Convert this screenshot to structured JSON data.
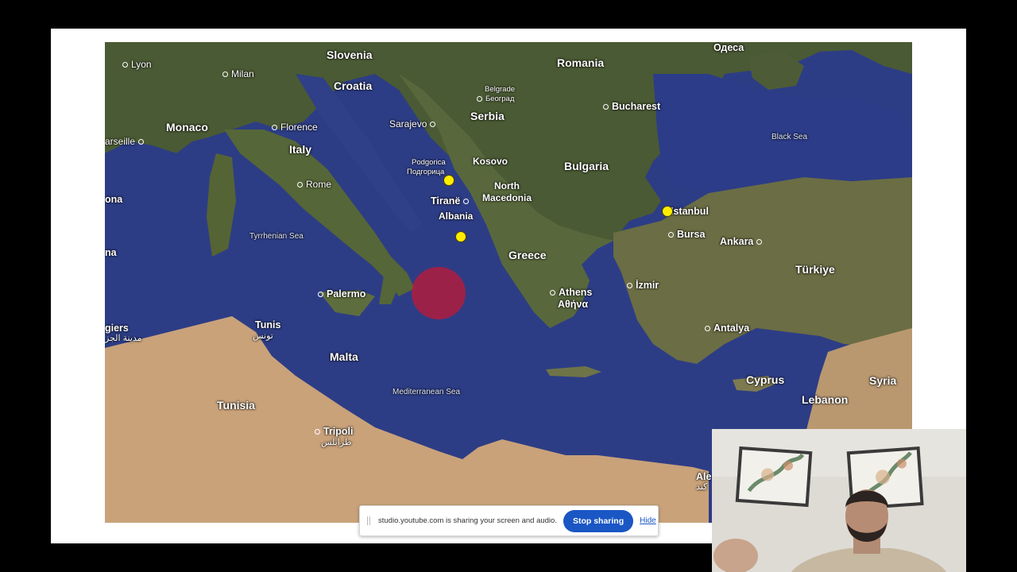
{
  "map": {
    "countries": {
      "slovenia": "Slovenia",
      "croatia": "Croatia",
      "romania": "Romania",
      "serbia": "Serbia",
      "bulgaria": "Bulgaria",
      "kosovo": "Kosovo",
      "north_macedonia_1": "North",
      "north_macedonia_2": "Macedonia",
      "albania": "Albania",
      "greece": "Greece",
      "italy": "Italy",
      "monaco": "Monaco",
      "malta": "Malta",
      "tunisia": "Tunisia",
      "turkiye": "Türkiye",
      "cyprus": "Cyprus",
      "lebanon": "Lebanon",
      "syria": "Syria"
    },
    "cities": {
      "lyon": "Lyon",
      "milan": "Milan",
      "marseille": "arseille",
      "florence": "Florence",
      "rome": "Rome",
      "sarajevo": "Sarajevo",
      "belgrade_1": "Belgrade",
      "belgrade_2": "Београд",
      "bucharest": "Bucharest",
      "odesa": "Одеса",
      "podgorica_1": "Podgorica",
      "podgorica_2": "Подгорица",
      "tirane": "Tiranë",
      "istanbul": "Istanbul",
      "bursa": "Bursa",
      "ankara": "Ankara",
      "izmir": "İzmir",
      "athens_1": "Athens",
      "athens_2": "Αθήνα",
      "palermo": "Palermo",
      "tunis_1": "Tunis",
      "tunis_2": "تونس",
      "algiers_1": "giers",
      "algiers_2": "مدينة الجز",
      "antalya": "Antalya",
      "tripoli_1": "Tripoli",
      "tripoli_2": "طرابلس",
      "alexandria_1": "Ale",
      "alexandria_2": "كند",
      "barcelona": "ona",
      "valencia": "na"
    },
    "seas": {
      "black": "Black Sea",
      "tyrrhenian": "Tyrrhenian Sea",
      "mediterranean": "Mediterranean Sea"
    }
  },
  "share_bar": {
    "message": "studio.youtube.com is sharing your screen and audio.",
    "stop_label": "Stop sharing",
    "hide_label": "Hide"
  },
  "colors": {
    "marker": "#ffee00",
    "zone": "#c81632",
    "stop_button": "#1a56c4"
  }
}
